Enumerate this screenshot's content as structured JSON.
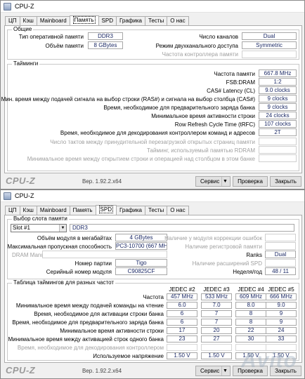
{
  "app": {
    "title": "CPU-Z",
    "brand": "CPU-Z",
    "version": "Вер. 1.92.2.x64"
  },
  "tabs": [
    "ЦП",
    "Кэш",
    "Mainboard",
    "Память",
    "SPD",
    "Графика",
    "Тесты",
    "О нас"
  ],
  "footer": {
    "service": "Сервис",
    "check": "Проверка",
    "close": "Закрыть"
  },
  "memory": {
    "general": {
      "title": "Общие",
      "type_label": "Тип оперативной памяти",
      "type": "DDR3",
      "size_label": "Объём памяти",
      "size": "8 GBytes",
      "channels_label": "Число каналов",
      "channels": "Dual",
      "dc_mode_label": "Режим двухканального доступа",
      "dc_mode": "Symmetric",
      "nb_freq_label": "Частота контроллера памяти"
    },
    "timings": {
      "title": "Тайминги",
      "rows": [
        {
          "label": "Частота памяти",
          "value": "667.8 MHz"
        },
        {
          "label": "FSB:DRAM",
          "value": "1:2"
        },
        {
          "label": "CAS# Latency (CL)",
          "value": "9.0 clocks"
        },
        {
          "label": "Мин. время между подачей сигнала на выбор строки (RAS#) и сигнала на выбор столбца (CAS#)",
          "value": "9 clocks"
        },
        {
          "label": "Время, необходимое для предварительного заряда банка",
          "value": "9 clocks"
        },
        {
          "label": "Минимальное время активности строки",
          "value": "24 clocks"
        },
        {
          "label": "Row Refresh Cycle Time (tRFC)",
          "value": "107 clocks"
        },
        {
          "label": "Время, необходимое для декодирования контроллером команд и адресов",
          "value": "2T"
        }
      ],
      "disabled_rows": [
        "Число тактов между принудительной перезагрузкой открытых страниц памяти",
        "Тайминг, используемый памятью RDRAM",
        "Минимальное время между открытием строки и операцией над столбцом в этом банке"
      ]
    }
  },
  "spd": {
    "slot_group_title": "Выбор слота памяти",
    "slot": "Slot #1",
    "type": "DDR3",
    "module_size_label": "Объём модуля в мегабайтах",
    "module_size": "4 GBytes",
    "bandwidth_label": "Максимальная пропускная способность",
    "bandwidth": "PC3-10700 (667 MHz)",
    "dram_manuf_label": "DRAM Manuf.a",
    "part_label": "Номер партии",
    "part": "Tigo",
    "serial_label": "Серийный номер модуля",
    "serial": "C90825CF",
    "ecc_label": "Наличие у модуля коррекции ошибок",
    "registered_label": "Наличие регистровой памяти",
    "ranks_label": "Ranks",
    "ranks": "Dual",
    "spd_ext_label": "Наличие расширений SPD",
    "week_year_label": "Неделя/год",
    "week_year": "48 / 11",
    "table_title": "Таблица таймингов для разных частот",
    "columns": [
      "JEDEC #2",
      "JEDEC #3",
      "JEDEC #4",
      "JEDEC #5"
    ],
    "rows": [
      {
        "label": "Частота",
        "values": [
          "457 MHz",
          "533 MHz",
          "609 MHz",
          "666 MHz"
        ]
      },
      {
        "label": "Минимальное время между подачей команды на чтение",
        "values": [
          "6.0",
          "7.0",
          "8.0",
          "9.0"
        ]
      },
      {
        "label": "Время, необходимое для активации строки банка",
        "values": [
          "6",
          "7",
          "8",
          "9"
        ]
      },
      {
        "label": "Время, необходимое для предварительного заряда банка",
        "values": [
          "6",
          "7",
          "8",
          "9"
        ]
      },
      {
        "label": "Минимальное время активности строки",
        "values": [
          "17",
          "20",
          "22",
          "24"
        ]
      },
      {
        "label": "Минимальное время между активацией строк одного банка",
        "values": [
          "23",
          "27",
          "30",
          "33"
        ]
      },
      {
        "label": "Время, необходимое для декодирования контроллером",
        "values": [
          "",
          "",
          "",
          ""
        ],
        "disabled": true
      },
      {
        "label": "Используемое напряжение",
        "values": [
          "1.50 V",
          "1.50 V",
          "1.50 V",
          "1.50 V"
        ]
      }
    ]
  },
  "watermark": "Avito"
}
